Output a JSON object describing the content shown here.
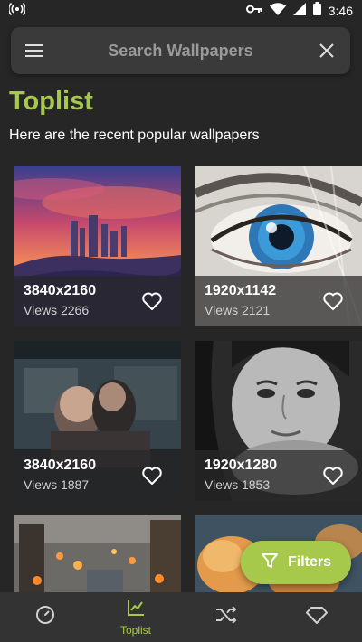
{
  "status": {
    "time": "3:46"
  },
  "search": {
    "placeholder": "Search Wallpapers"
  },
  "page": {
    "title": "Toplist",
    "subtitle": "Here are the recent popular wallpapers"
  },
  "wallpapers": [
    {
      "resolution": "3840x2160",
      "views": "Views 2266",
      "subject": "sunset city skyline"
    },
    {
      "resolution": "1920x1142",
      "views": "Views 2121",
      "subject": "blue eye close-up"
    },
    {
      "resolution": "3840x2160",
      "views": "Views 1887",
      "subject": "anime couple room"
    },
    {
      "resolution": "1920x1280",
      "views": "Views 1853",
      "subject": "black and white portrait"
    },
    {
      "resolution": "",
      "views": "",
      "subject": "foggy city street lights"
    },
    {
      "resolution": "",
      "views": "",
      "subject": "orange flowers"
    }
  ],
  "fab": {
    "label": "Filters"
  },
  "nav": [
    {
      "icon": "compass-icon",
      "label": ""
    },
    {
      "icon": "trending-chart-icon",
      "label": "Toplist"
    },
    {
      "icon": "shuffle-icon",
      "label": ""
    },
    {
      "icon": "diamond-icon",
      "label": ""
    }
  ],
  "colors": {
    "accent": "#a7c94b",
    "background": "#262626",
    "search_bar": "#3a3a3a",
    "nav_bar": "#333333"
  }
}
